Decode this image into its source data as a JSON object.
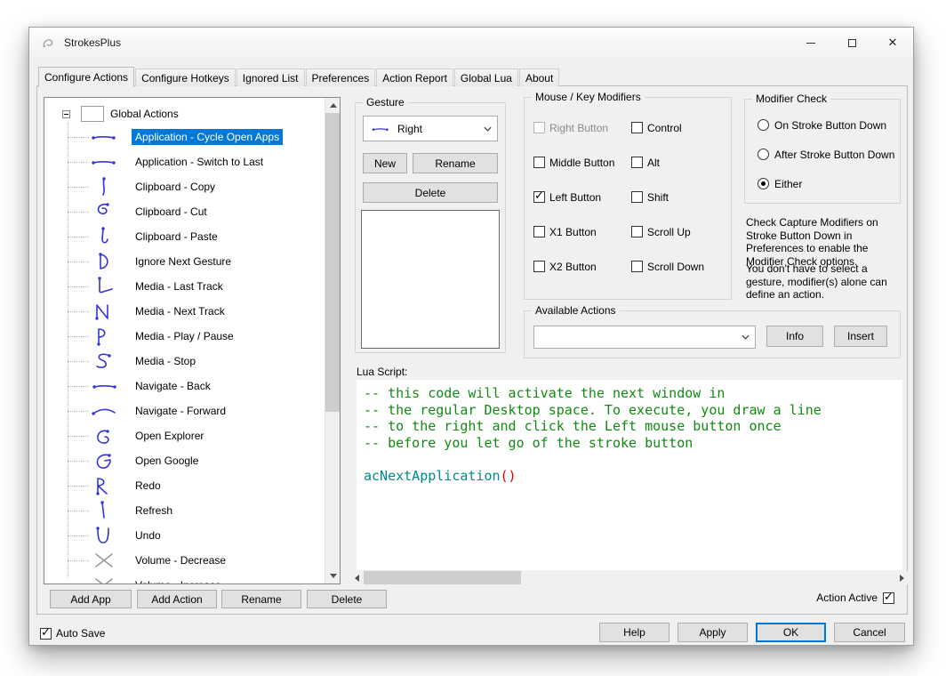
{
  "colors": {
    "selection_accent": "#0078d7",
    "gesture_stroke": "#3434d6",
    "lua_comment_green": "#128a12",
    "lua_function_teal": "#008b8b",
    "lua_operator_red": "#d40000"
  },
  "window": {
    "title": "StrokesPlus"
  },
  "tabs": [
    {
      "label": "Configure Actions",
      "active": true
    },
    {
      "label": "Configure Hotkeys",
      "active": false
    },
    {
      "label": "Ignored List",
      "active": false
    },
    {
      "label": "Preferences",
      "active": false
    },
    {
      "label": "Action Report",
      "active": false
    },
    {
      "label": "Global Lua",
      "active": false
    },
    {
      "label": "About",
      "active": false
    }
  ],
  "tree": {
    "root_label": "Global Actions",
    "items": [
      {
        "label": "Application - Cycle Open Apps",
        "selected": true,
        "gesture": "line-right"
      },
      {
        "label": "Application - Switch to Last",
        "selected": false,
        "gesture": "line-right"
      },
      {
        "label": "Clipboard - Copy",
        "selected": false,
        "gesture": "down-squiggle"
      },
      {
        "label": "Clipboard - Cut",
        "selected": false,
        "gesture": "loop"
      },
      {
        "label": "Clipboard - Paste",
        "selected": false,
        "gesture": "down-hook"
      },
      {
        "label": "Ignore Next Gesture",
        "selected": false,
        "gesture": "d-shape"
      },
      {
        "label": "Media - Last Track",
        "selected": false,
        "gesture": "l-shape"
      },
      {
        "label": "Media - Next Track",
        "selected": false,
        "gesture": "n-shape"
      },
      {
        "label": "Media - Play / Pause",
        "selected": false,
        "gesture": "p-shape"
      },
      {
        "label": "Media - Stop",
        "selected": false,
        "gesture": "s-shape"
      },
      {
        "label": "Navigate - Back",
        "selected": false,
        "gesture": "line-left"
      },
      {
        "label": "Navigate - Forward",
        "selected": false,
        "gesture": "curve-right"
      },
      {
        "label": "Open Explorer",
        "selected": false,
        "gesture": "e-shape"
      },
      {
        "label": "Open Google",
        "selected": false,
        "gesture": "g-shape"
      },
      {
        "label": "Redo",
        "selected": false,
        "gesture": "r-shape"
      },
      {
        "label": "Refresh",
        "selected": false,
        "gesture": "down-line"
      },
      {
        "label": "Undo",
        "selected": false,
        "gesture": "u-shape"
      },
      {
        "label": "Volume - Decrease",
        "selected": false,
        "gesture": "x-shape"
      },
      {
        "label": "Volume - Increase",
        "selected": false,
        "gesture": "x-shape"
      }
    ]
  },
  "gesture_panel": {
    "group_label": "Gesture",
    "selected_gesture": "Right",
    "new_button": "New",
    "rename_button": "Rename",
    "delete_button": "Delete"
  },
  "modifiers_panel": {
    "group_label": "Mouse / Key Modifiers",
    "checkboxes": [
      {
        "label": "Right Button",
        "checked": false,
        "disabled": true
      },
      {
        "label": "Middle Button",
        "checked": false,
        "disabled": false
      },
      {
        "label": "Left Button",
        "checked": true,
        "disabled": false
      },
      {
        "label": "X1 Button",
        "checked": false,
        "disabled": false
      },
      {
        "label": "X2 Button",
        "checked": false,
        "disabled": false
      },
      {
        "label": "Control",
        "checked": false,
        "disabled": false
      },
      {
        "label": "Alt",
        "checked": false,
        "disabled": false
      },
      {
        "label": "Shift",
        "checked": false,
        "disabled": false
      },
      {
        "label": "Scroll Up",
        "checked": false,
        "disabled": false
      },
      {
        "label": "Scroll Down",
        "checked": false,
        "disabled": false
      }
    ]
  },
  "modifier_check_panel": {
    "group_label": "Modifier Check",
    "options": [
      {
        "label": "On Stroke Button Down",
        "selected": false
      },
      {
        "label": "After Stroke Button Down",
        "selected": false
      },
      {
        "label": "Either",
        "selected": true
      }
    ],
    "note_primary": "Check Capture Modifiers on Stroke Button Down in Preferences to enable the Modifier Check options.",
    "note_secondary": "You don't have to select a gesture, modifier(s) alone can define an action."
  },
  "available_actions_panel": {
    "group_label": "Available Actions",
    "selected_value": "",
    "info_button": "Info",
    "insert_button": "Insert"
  },
  "lua_editor": {
    "label": "Lua Script:",
    "comment_lines": [
      "-- this code will activate the next window in",
      "-- the regular Desktop space. To execute, you draw a line",
      "-- to the right and click the Left mouse button once",
      "-- before you let go of the stroke button"
    ],
    "call_function": "acNextApplication",
    "call_operator": "()"
  },
  "action_buttons": {
    "add_app": "Add App",
    "add_action": "Add Action",
    "rename": "Rename",
    "delete": "Delete",
    "action_active_label": "Action Active",
    "action_active_checked": true
  },
  "footer": {
    "auto_save_label": "Auto Save",
    "auto_save_checked": true,
    "help_button": "Help",
    "apply_button": "Apply",
    "ok_button": "OK",
    "cancel_button": "Cancel"
  }
}
